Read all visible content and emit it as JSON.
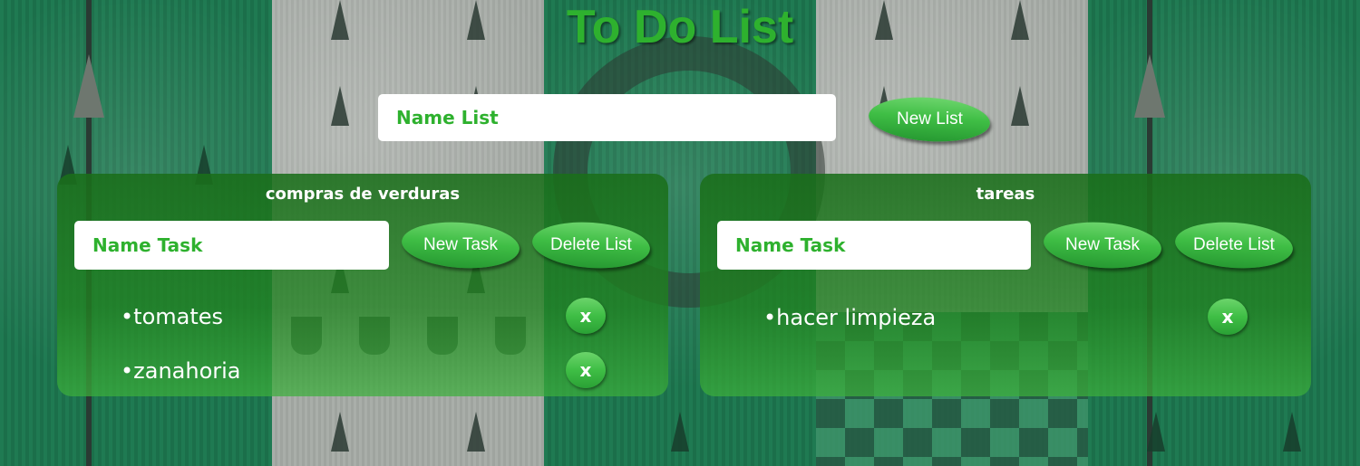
{
  "app": {
    "title": "To Do List"
  },
  "new_list": {
    "placeholder": "Name List",
    "button_label": "New List"
  },
  "lists": [
    {
      "title": "compras de verduras",
      "task_placeholder": "Name Task",
      "new_task_label": "New Task",
      "delete_label": "Delete List",
      "tasks": [
        {
          "text": "•tomates",
          "delete_label": "x"
        },
        {
          "text": "•zanahoria",
          "delete_label": "x"
        }
      ]
    },
    {
      "title": "tareas",
      "task_placeholder": "Name Task",
      "new_task_label": "New Task",
      "delete_label": "Delete List",
      "tasks": [
        {
          "text": "•hacer limpieza",
          "delete_label": "x"
        }
      ]
    }
  ],
  "colors": {
    "accent": "#2eb12e",
    "button": "#3fbe45",
    "card": "#1f7f1f"
  }
}
